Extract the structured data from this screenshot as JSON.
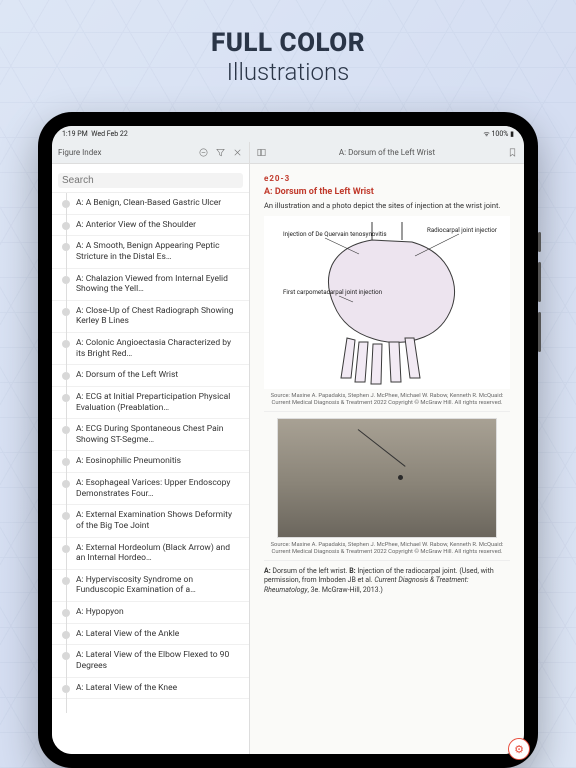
{
  "headline": {
    "bold": "FULL COLOR",
    "light": "Illustrations"
  },
  "status": {
    "time": "1:19 PM",
    "date": "Wed Feb 22",
    "battery": "100%"
  },
  "topbar": {
    "left_title": "Figure Index",
    "right_center": "A: Dorsum of the Left Wrist"
  },
  "search": {
    "placeholder": "Search"
  },
  "sidebar": {
    "items": [
      "A: A Benign, Clean-Based Gastric Ulcer",
      "A: Anterior View of the Shoulder",
      "A: A Smooth, Benign Appearing Peptic Stricture in the Distal Es…",
      "A: Chalazion Viewed from Internal Eyelid Showing the Yell…",
      "A: Close-Up of Chest Radiograph Showing Kerley B Lines",
      "A: Colonic Angioectasia Characterized by its Bright Red…",
      "A: Dorsum of the Left Wrist",
      "A: ECG at Initial Preparticipation Physical Evaluation (Preablation…",
      "A: ECG During Spontaneous Chest Pain Showing ST-Segme…",
      "A: Eosinophilic Pneumonitis",
      "A: Esophageal Varices: Upper Endoscopy Demonstrates Four…",
      "A: External Examination Shows Deformity of the Big Toe Joint",
      "A: External Hordeolum (Black Arrow)  and  an Internal Hordeo…",
      "A: Hyperviscosity Syndrome on Funduscopic Examination of a…",
      "A: Hypopyon",
      "A: Lateral View of the Ankle",
      "A: Lateral View of the Elbow Flexed to 90 Degrees",
      "A: Lateral View of the Knee"
    ]
  },
  "article": {
    "figure_number": "e20-3",
    "title": "A: Dorsum of the Left Wrist",
    "description": "An illustration and a photo depict the sites of injection at the wrist joint.",
    "labels": {
      "l1": "Injection of De Quervain tenosynovitis",
      "l2": "Radiocarpal joint injection",
      "l3": "First carpometacarpal joint injection"
    },
    "credit1": "Source: Maxine A. Papadakis, Stephen J. McPhee, Michael W. Rabow, Kenneth R. McQuaid: Current Medical Diagnosis & Treatment 2022 Copyright © McGraw Hill. All rights reserved.",
    "credit2": "Source: Maxine A. Papadakis, Stephen J. McPhee, Michael W. Rabow, Kenneth R. McQuaid: Current Medical Diagnosis & Treatment 2022 Copyright © McGraw Hill. All rights reserved.",
    "caption_a": "A:",
    "caption_a_text": " Dorsum of the left wrist. ",
    "caption_b": "B:",
    "caption_b_text": " Injection of the radiocarpal joint. (Used, with permission, from Imboden JB et al. ",
    "caption_em": "Current Diagnosis & Treatment: Rheumatology",
    "caption_tail": ", 3e. McGraw-Hill, 2013.)"
  }
}
